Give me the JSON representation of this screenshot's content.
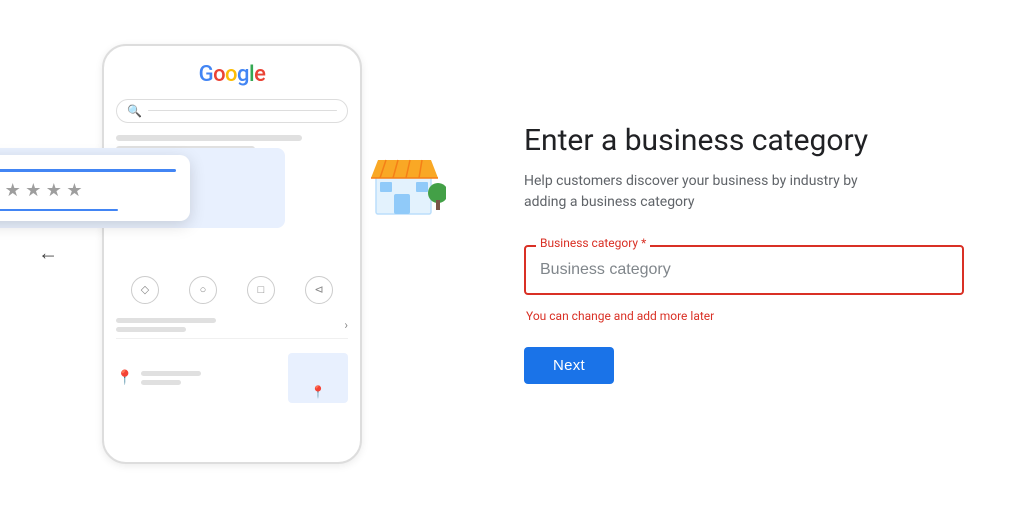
{
  "page": {
    "title": "Enter a business category",
    "subtitle": "Help customers discover your business by industry by adding a business category"
  },
  "form": {
    "field_label": "Business category *",
    "field_placeholder": "Business category",
    "field_hint": "You can change and add more later",
    "next_button_label": "Next"
  },
  "back_button": {
    "label": "←"
  },
  "google_logo": {
    "text": "Google"
  },
  "icons": {
    "search": "🔍",
    "location": "◇",
    "phone": "○",
    "bookmark": "⬜",
    "share": "◁",
    "map_pin": "📍"
  },
  "colors": {
    "primary_blue": "#1a73e8",
    "error_red": "#d93025",
    "text_dark": "#202124",
    "text_medium": "#5f6368",
    "border_red": "#d93025"
  }
}
